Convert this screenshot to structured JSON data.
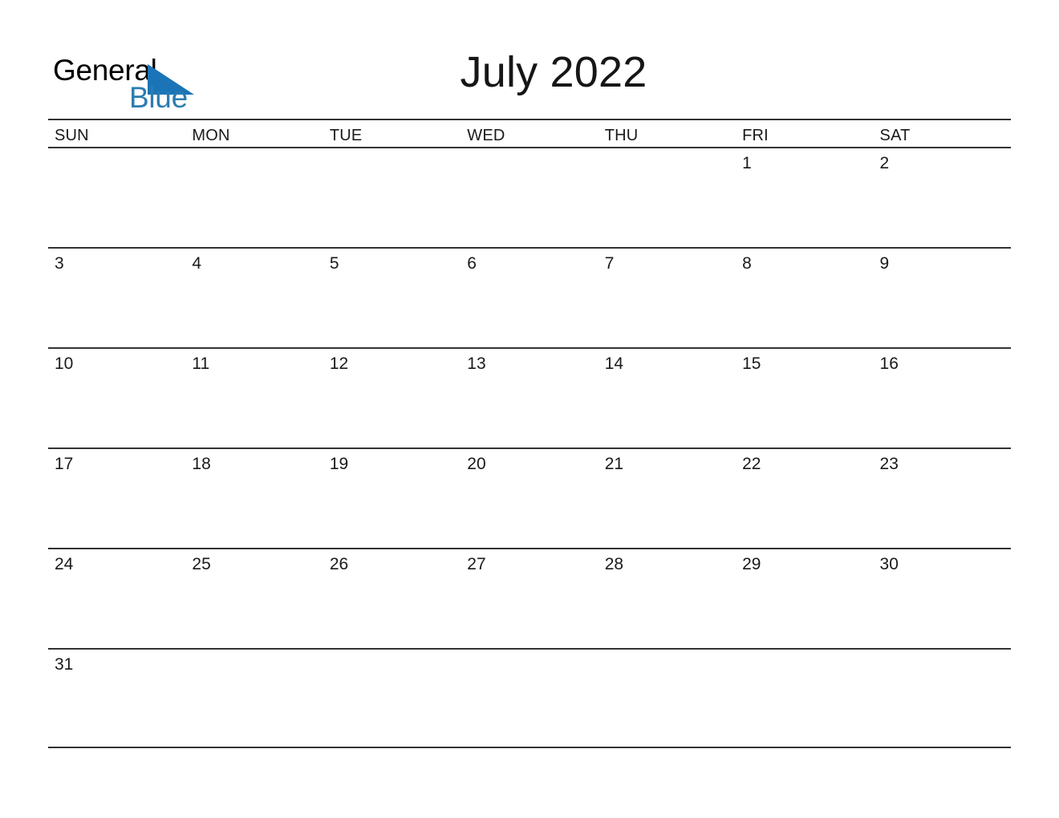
{
  "brand": {
    "name_part1": "General",
    "name_part2": "Blue",
    "triangle_icon": "blue-triangle-icon",
    "colors": {
      "triangle": "#1b74b8",
      "blue_text": "#2b7cb0",
      "black_text": "#000000"
    }
  },
  "header": {
    "title": "July 2022",
    "month": "July",
    "year": "2022"
  },
  "calendar": {
    "weekdays": [
      "SUN",
      "MON",
      "TUE",
      "WED",
      "THU",
      "FRI",
      "SAT"
    ],
    "rule_color": "#333333",
    "weeks": [
      [
        "",
        "",
        "",
        "",
        "",
        "1",
        "2"
      ],
      [
        "3",
        "4",
        "5",
        "6",
        "7",
        "8",
        "9"
      ],
      [
        "10",
        "11",
        "12",
        "13",
        "14",
        "15",
        "16"
      ],
      [
        "17",
        "18",
        "19",
        "20",
        "21",
        "22",
        "23"
      ],
      [
        "24",
        "25",
        "26",
        "27",
        "28",
        "29",
        "30"
      ],
      [
        "31",
        "",
        "",
        "",
        "",
        "",
        ""
      ]
    ]
  }
}
